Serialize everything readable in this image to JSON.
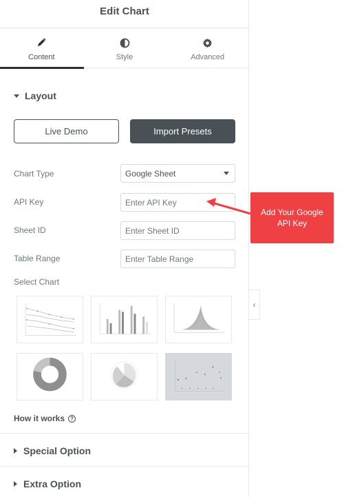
{
  "header": {
    "title": "Edit Chart"
  },
  "tabs": [
    {
      "label": "Content",
      "icon": "pencil-icon",
      "active": true
    },
    {
      "label": "Style",
      "icon": "half-circle-icon",
      "active": false
    },
    {
      "label": "Advanced",
      "icon": "gear-icon",
      "active": false
    }
  ],
  "layout": {
    "title": "Layout",
    "live_demo_label": "Live Demo",
    "import_presets_label": "Import Presets",
    "chart_type": {
      "label": "Chart Type",
      "value": "Google Sheet"
    },
    "api_key": {
      "label": "API Key",
      "placeholder": "Enter API Key"
    },
    "sheet_id": {
      "label": "Sheet ID",
      "placeholder": "Enter Sheet ID"
    },
    "table_range": {
      "label": "Table Range",
      "placeholder": "Enter Table Range"
    },
    "select_chart_label": "Select Chart",
    "chart_options": [
      "line-chart",
      "bar-chart",
      "area-chart",
      "donut-chart",
      "polar-chart",
      "scatter-chart"
    ],
    "selected_chart": "scatter-chart",
    "how_it_works_label": "How it works"
  },
  "sections": {
    "special_option": "Special Option",
    "extra_option": "Extra Option"
  },
  "annotation": {
    "text": "Add Your Google API Key"
  },
  "colors": {
    "accent_dark": "#495157",
    "callout_red": "#ef4044"
  }
}
